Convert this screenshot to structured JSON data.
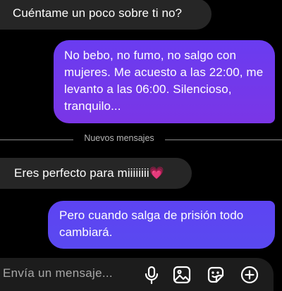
{
  "messages": [
    {
      "direction": "incoming",
      "text": "Cuéntame un poco sobre ti no?"
    },
    {
      "direction": "outgoing",
      "text": "No bebo, no fumo, no salgo con mujeres. Me acuesto a las 22:00, me levanto a las 06:00. Silencioso, tranquilo..."
    },
    {
      "direction": "incoming",
      "text": "Eres perfecto para miiiiiiii",
      "emoji": "💗"
    },
    {
      "direction": "outgoing",
      "text": "Pero cuando salga de prisión todo cambiará."
    }
  ],
  "divider": {
    "label": "Nuevos mensajes"
  },
  "composer": {
    "placeholder": "Envía un mensaje...",
    "icons": [
      "microphone-icon",
      "gallery-icon",
      "sticker-icon",
      "add-icon"
    ]
  },
  "colors": {
    "background": "#000000",
    "incoming_bubble": "#262626",
    "outgoing_bubble": "#6a3cf0",
    "outgoing_bubble_2": "#5d44f2",
    "composer": "#1c1c1c",
    "heart": "#f36bd2"
  }
}
